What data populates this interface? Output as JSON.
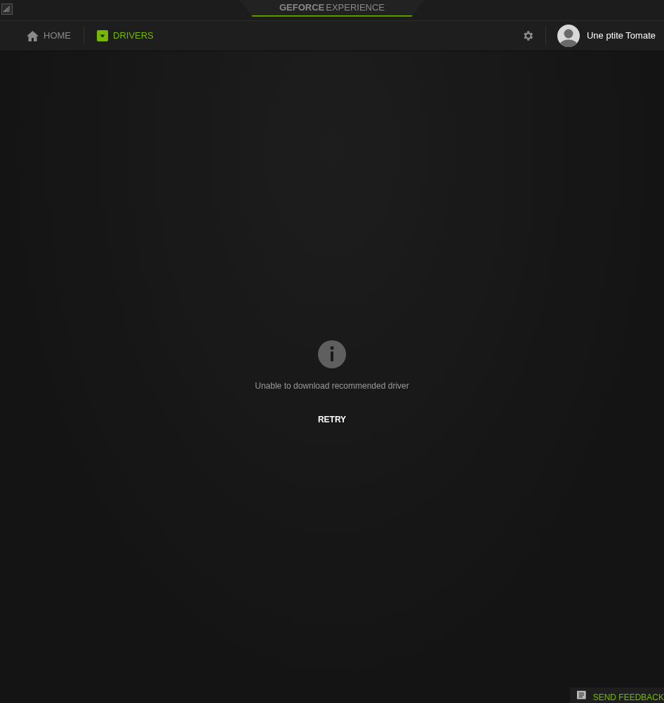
{
  "window": {
    "title_brand": "GEFORCE",
    "title_product": "EXPERIENCE"
  },
  "tabs": [
    {
      "label": "HOME",
      "kind": "home",
      "selected": false
    },
    {
      "label": "DRIVERS",
      "kind": "drivers",
      "selected": true
    }
  ],
  "user": {
    "name": "Une ptite Tomate"
  },
  "message": {
    "text": "Unable to download recommended driver",
    "action": "RETRY"
  },
  "feedback": {
    "label": "SEND FEEDBACK"
  }
}
